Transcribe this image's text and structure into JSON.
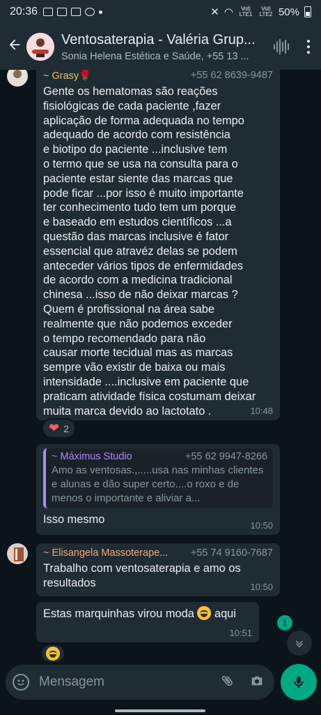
{
  "status_bar": {
    "time": "20:36",
    "lte1": "Vol) LTE1",
    "lte2": "Vol) LTE2",
    "battery": "50%"
  },
  "header": {
    "title": "Ventosaterapia - Valéria Grup...",
    "subtitle": "Sonia Helena Estética e Saúde, +55 13 ..."
  },
  "messages": [
    {
      "sender": "~ Grasy🌹",
      "sender_color": "#e9c46a",
      "phone": "+55 62 8639-9487",
      "text": "Gente os hematomas são reações\nfisiológicas de cada paciente ,fazer\naplicação de forma adequada no tempo\nadequado de acordo com resistência\ne biotipo do paciente ...inclusive tem\no termo que se usa na consulta para o\npaciente estar siente das marcas que\npode ficar ...por isso é muito importante\nter conhecimento tudo tem um porque\ne baseado em estudos científicos ...a\nquestão das marcas inclusive é fator\nessencial que atravéz delas se podem\nanteceder vários tipos de enfermidades\nde acordo com a medicina tradicional\nchinesa ...isso de não deixar marcas ?\nQuem é profissional na área sabe\nrealmente que não podemos exceder\no tempo recomendado para não\ncausar morte tecidual mas as marcas\nsempre vão existir de baixa ou mais\nintensidade ....inclusive em paciente que\npraticam atividade física costumam deixar\nmuita marca devido ao lactotato .",
      "time": "10:48",
      "reaction_count": "2"
    },
    {
      "quote_name": "~ Máximus Studio",
      "quote_phone": "+55 62 9947-8266",
      "quote_text": "Amo as ventosas.,.....usa nas minhas clientes e alunas e dão super certo....o roxo e de menos o importante e aliviar a...",
      "text": "Isso mesmo",
      "time": "10:50"
    },
    {
      "sender": "~ Elisangela Massoterape...",
      "sender_color": "#f4a582",
      "phone": "+55 74 9160-7687",
      "text": "Trabalho com ventosaterapia e amo os\nresultados",
      "time": "10:50"
    },
    {
      "text": "Estas  marquinhas virou moda",
      "text_after": " aqui",
      "time": "10:51"
    }
  ],
  "unread_count": "1",
  "input": {
    "placeholder": "Mensagem"
  },
  "icons": {
    "back": "arrow-left-icon",
    "voice_chat": "waveform-icon",
    "menu": "kebab-icon",
    "emoji": "emoji-icon",
    "attach": "paperclip-icon",
    "camera": "camera-icon",
    "mic": "mic-icon"
  },
  "colors": {
    "accent": "#00a884",
    "bubble": "#202c33",
    "background": "#0b141a"
  }
}
